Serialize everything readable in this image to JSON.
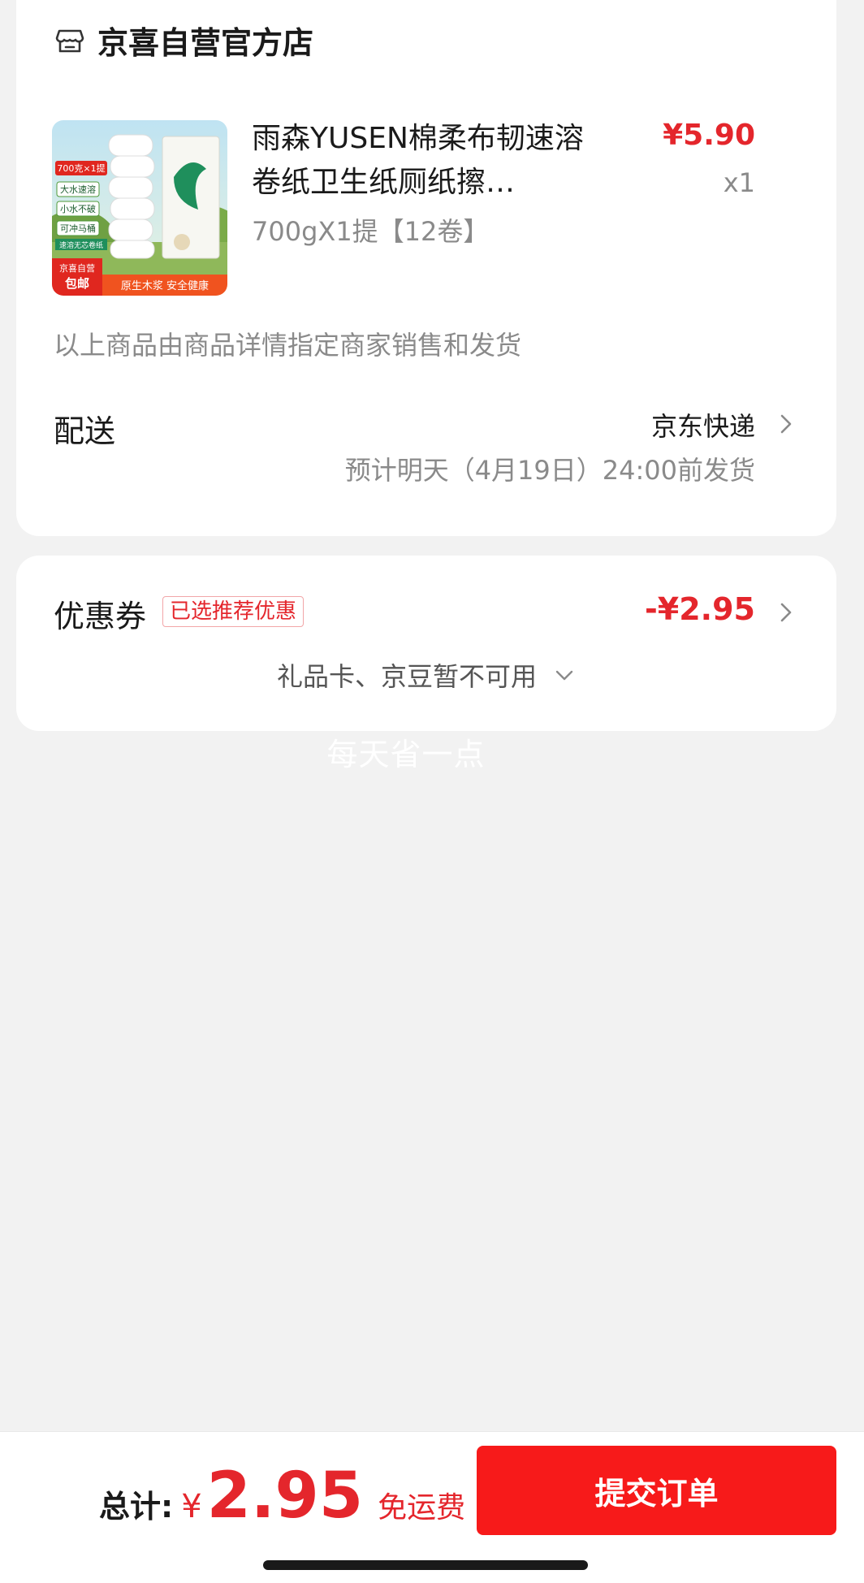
{
  "store": {
    "name": "京喜自营官方店",
    "icon": "store-icon"
  },
  "product": {
    "title": "雨森YUSEN棉柔布韧速溶卷纸卫生纸厕纸擦…",
    "spec": "700gX1提【12卷】",
    "price": "¥5.90",
    "quantity": "x1",
    "image": {
      "top_badge": "700克×1提",
      "features": [
        "大水速溶",
        "小水不破",
        "可冲马桶"
      ],
      "green_strip": "速溶无芯卷纸",
      "corner_tag_top": "京喜自营",
      "corner_tag_bottom": "包邮",
      "bottom_banner": "原生木浆 安全健康"
    }
  },
  "seller_note": "以上商品由商品详情指定商家销售和发货",
  "delivery": {
    "label": "配送",
    "method": "京东快递",
    "estimate": "预计明天（4月19日）24:00前发货"
  },
  "coupon": {
    "label": "优惠券",
    "badge": "已选推荐优惠",
    "discount": "-¥2.95",
    "note": "礼品卡、京豆暂不可用"
  },
  "watermark": "每天省一点",
  "footer": {
    "total_label": "总计:",
    "currency": "¥",
    "total_amount": "2.95",
    "shipping": "免运费",
    "submit_label": "提交订单"
  },
  "colors": {
    "accent_red": "#e4262c",
    "button_red": "#f71a1a",
    "background": "#f2f2f2"
  }
}
